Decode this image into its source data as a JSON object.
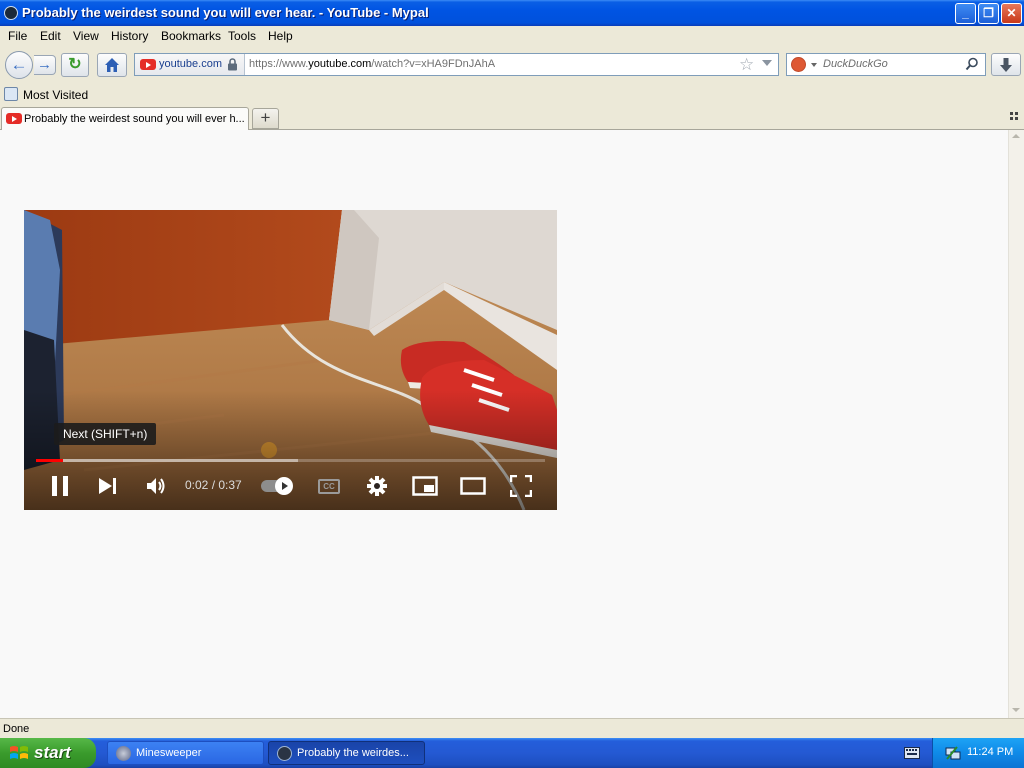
{
  "window": {
    "title": "Probably the weirdest sound you will ever hear. - YouTube - Mypal",
    "minimize": "_",
    "maximize": "❐",
    "close": "✕"
  },
  "menu": [
    "File",
    "Edit",
    "View",
    "History",
    "Bookmarks",
    "Tools",
    "Help"
  ],
  "nav": {
    "identity_domain": "youtube.com",
    "url_prefix": "https://www.",
    "url_domain": "youtube.com",
    "url_path": "/watch?v=xHA9FDnJAhA",
    "search_placeholder": "DuckDuckGo"
  },
  "bookmarks_toolbar": {
    "most_visited": "Most Visited"
  },
  "tabs": {
    "active_title": "Probably the weirdest sound you will ever h...",
    "new_tab": "+"
  },
  "video": {
    "tooltip": "Next (SHIFT+n)",
    "time": "0:02 / 0:37",
    "played_fraction": 0.054,
    "buffered_fraction": 0.515
  },
  "status": {
    "text": "Done"
  },
  "taskbar": {
    "start": "start",
    "items": [
      "Minesweeper",
      "Probably the weirdes..."
    ],
    "clock": "11:24 PM"
  }
}
